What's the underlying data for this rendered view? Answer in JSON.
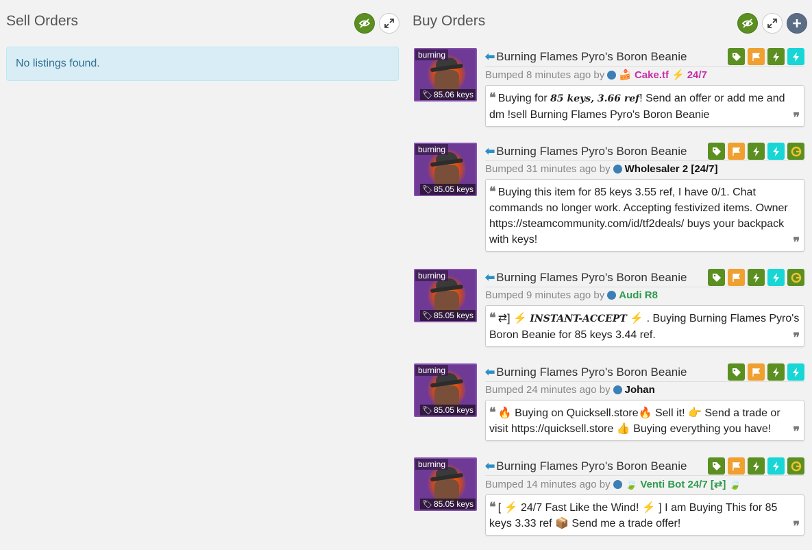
{
  "sell": {
    "title": "Sell Orders",
    "empty": "No listings found."
  },
  "buy": {
    "title": "Buy Orders",
    "listings": [
      {
        "quality": "burning",
        "price": "85.06 keys",
        "name": "Burning Flames Pyro's Boron Beanie",
        "bumped": "Bumped 8 minutes ago by",
        "user": "Cake.tf",
        "user_suffix": "24/7",
        "user_color": "#c72ea8",
        "comment_pre": "Buying for ",
        "comment_bold": "85 keys, 3.66 ref",
        "comment_post": "! Send an offer or add me and dm !sell Burning Flames Pyro's Boron Beanie"
      },
      {
        "quality": "burning",
        "price": "85.05 keys",
        "name": "Burning Flames Pyro's Boron Beanie",
        "bumped": "Bumped 31 minutes ago by",
        "user": "Wholesaler 2 [24/7]",
        "user_color": "#111111",
        "comment": "Buying this item for 85 keys 3.55 ref, I have 0/1. Chat commands no longer work. Accepting festivized items. Owner https://steamcommunity.com/id/tf2deals/ buys your backpack with keys!"
      },
      {
        "quality": "burning",
        "price": "85.05 keys",
        "name": "Burning Flames Pyro's Boron Beanie",
        "bumped": "Bumped 9 minutes ago by",
        "user": "Audi R8",
        "user_color": "#2e9a4e",
        "comment_pre": "⇄] ",
        "comment_bold": "INSTANT-ACCEPT",
        "comment_post": " . Buying Burning Flames Pyro's Boron Beanie for 85 keys 3.44 ref."
      },
      {
        "quality": "burning",
        "price": "85.05 keys",
        "name": "Burning Flames Pyro's Boron Beanie",
        "bumped": "Bumped 24 minutes ago by",
        "user": "Johan",
        "user_color": "#111111",
        "comment_a": "Buying on Quicksell.store",
        "comment_b": " Sell it! ",
        "comment_c": " Send a trade or visit https://quicksell.store ",
        "comment_d": " Buying everything you have!"
      },
      {
        "quality": "burning",
        "price": "85.05 keys",
        "name": "Burning Flames Pyro's Boron Beanie",
        "bumped": "Bumped 14 minutes ago by",
        "user": "Venti Bot 24/7 [⇄]",
        "user_color": "#2e9a4e",
        "comment_a": "[ ",
        "comment_b": " 24/7 Fast Like the Wind! ",
        "comment_c": " ] I am Buying This for 85 keys 3.33 ref ",
        "comment_d": " Send me a trade offer!"
      }
    ]
  }
}
